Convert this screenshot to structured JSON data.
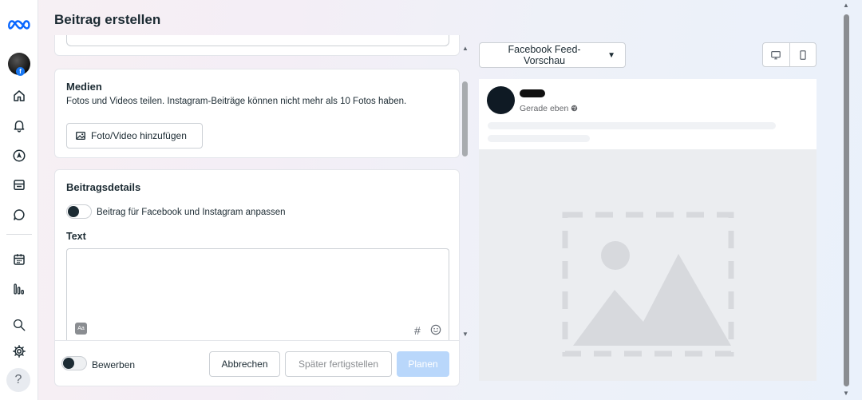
{
  "header": {
    "title": "Beitrag erstellen"
  },
  "media": {
    "heading": "Medien",
    "description": "Fotos und Videos teilen. Instagram-Beiträge können nicht mehr als 10 Fotos haben.",
    "add_button": "Foto/Video hinzufügen"
  },
  "details": {
    "heading": "Beitragsdetails",
    "customize_toggle_label": "Beitrag für Facebook und Instagram anpassen",
    "text_label": "Text",
    "text_value": ""
  },
  "footer": {
    "boost_label": "Bewerben",
    "cancel": "Abbrechen",
    "finish_later": "Später fertigstellen",
    "schedule": "Planen"
  },
  "preview": {
    "dropdown_label": "Facebook Feed-Vorschau",
    "timestamp": "Gerade eben"
  },
  "icons": {
    "logo": "meta-logo-icon",
    "home": "home-icon",
    "notifications": "bell-icon",
    "navigation": "compass-icon",
    "content": "content-library-icon",
    "inbox": "chat-bubble-icon",
    "planner": "calendar-icon",
    "insights": "bar-chart-icon",
    "search": "search-icon",
    "settings": "gear-icon",
    "help": "help-icon"
  },
  "colors": {
    "brand_blue": "#0866ff",
    "primary_disabled": "#b9d7fb",
    "text": "#1c2b33"
  }
}
